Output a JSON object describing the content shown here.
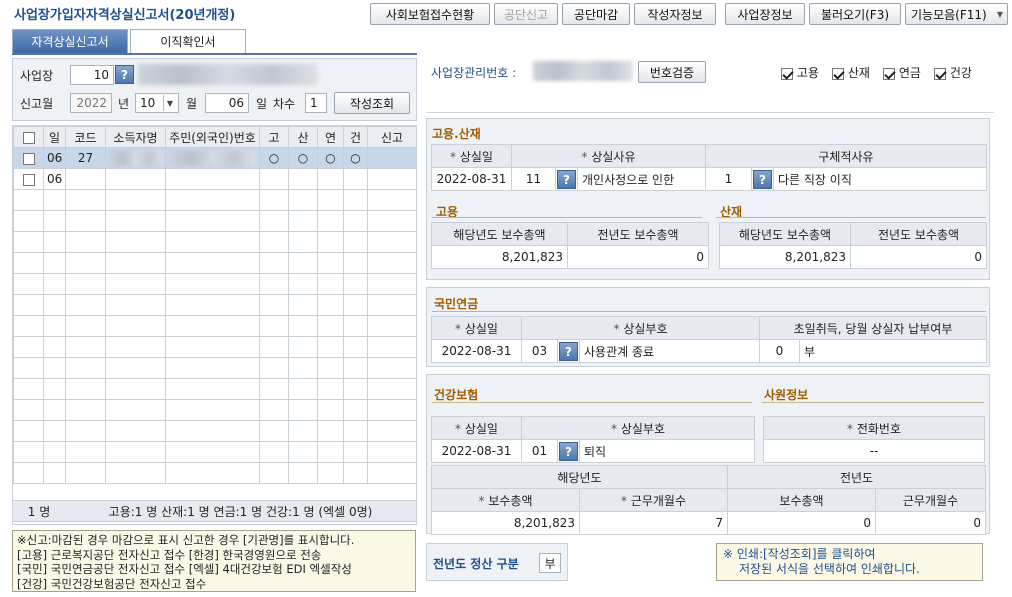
{
  "title": "사업장가입자자격상실신고서(20년개정)",
  "toolbar": [
    {
      "label": "사회보험접수현황",
      "enabled": true
    },
    {
      "label": "공단신고",
      "enabled": false
    },
    {
      "label": "공단마감",
      "enabled": true
    },
    {
      "label": "작성자정보",
      "enabled": true
    },
    {
      "label": "사업장정보",
      "enabled": true
    },
    {
      "label": "불러오기(F3)",
      "enabled": true
    },
    {
      "label": "기능모음(F11)",
      "enabled": true
    }
  ],
  "tabs": [
    "자격상실신고서",
    "이직확인서"
  ],
  "left": {
    "workplace_label": "사업장",
    "workplace_code": "10",
    "report_label": "신고월",
    "year": "2022",
    "year_suffix": "년",
    "month": "10",
    "month_suffix": "월",
    "day": "06",
    "day_suffix": "일",
    "seq_label": "차수",
    "seq": "1",
    "search_button": "작성조회"
  },
  "list": {
    "headers": [
      "일",
      "코드",
      "소득자명",
      "주민(외국인)번호",
      "고",
      "산",
      "연",
      "건",
      "신고"
    ],
    "rows": [
      {
        "day": "06",
        "code": "27",
        "go": "○",
        "san": "○",
        "yeon": "○",
        "geon": "○",
        "report": ""
      },
      {
        "day": "06",
        "code": "",
        "go": "",
        "san": "",
        "yeon": "",
        "geon": "",
        "report": ""
      }
    ],
    "footer_count": "1 명",
    "footer_summary": "고용:1 명 산재:1 명 연금:1 명 건강:1 명 (엑셀 0명)"
  },
  "notice": [
    "※신고:마감된 경우 마감으로 표시 신고한 경우 [기관명]를 표시합니다.",
    "[고용] 근로복지공단 전자신고 접수  [한경] 한국경영원으로 전송",
    "[국민] 국민연금공단 전자신고 접수  [엑셀] 4대건강보험 EDI 엑셀작성",
    "[건강] 국민건강보험공단 전자신고 접수"
  ],
  "right": {
    "mgmt_label": "사업장관리번호 :",
    "verify_button": "번호검증",
    "checks": [
      {
        "label": "고용",
        "on": true
      },
      {
        "label": "산재",
        "on": true
      },
      {
        "label": "연금",
        "on": true
      },
      {
        "label": "건강",
        "on": true
      }
    ],
    "employment": {
      "section_title": "고용.산재",
      "h_loss_date": "상실일",
      "h_loss_reason": "상실사유",
      "h_detail": "구체적사유",
      "loss_date": "2022-08-31",
      "reason_code": "11",
      "reason_text": "개인사정으로 인한",
      "detail_code": "1",
      "detail_text": "다른 직장 이직",
      "goyong_title": "고용",
      "sanjae_title": "산재",
      "h_cur_pay": "해당년도 보수총액",
      "h_prev_pay": "전년도 보수총액",
      "goyong_cur": "8,201,823",
      "goyong_prev": "0",
      "sanjae_cur": "8,201,823",
      "sanjae_prev": "0"
    },
    "pension": {
      "section_title": "국민연금",
      "h_loss_date": "상실일",
      "h_loss_code": "상실부호",
      "h_first": "초일취득, 당월 상실자 납부여부",
      "loss_date": "2022-08-31",
      "loss_code": "03",
      "loss_text": "사용관계 종료",
      "first_code": "0",
      "first_text": "부"
    },
    "health": {
      "section_title": "건강보험",
      "emp_title": "사원정보",
      "h_loss_date": "상실일",
      "h_loss_code": "상실부호",
      "h_phone": "전화번호",
      "loss_date": "2022-08-31",
      "loss_code": "01",
      "loss_text": "퇴직",
      "phone": "--",
      "h_cur_year": "해당년도",
      "h_prev_year": "전년도",
      "h_pay_total": "보수총액",
      "h_months": "근무개월수",
      "cur_pay": "8,201,823",
      "cur_months": "7",
      "prev_pay": "0",
      "prev_months": "0"
    },
    "settle_label": "전년도 정산 구분",
    "settle_value": "부",
    "print_note_1": "※ 인쇄:[작성조회]를 클릭하여",
    "print_note_2": "저장된 서식을 선택하여 인쇄합니다."
  },
  "colors": {
    "accent": "#1f4f8f",
    "section": "#a05a00",
    "selected_row": "#c8d6ea"
  }
}
